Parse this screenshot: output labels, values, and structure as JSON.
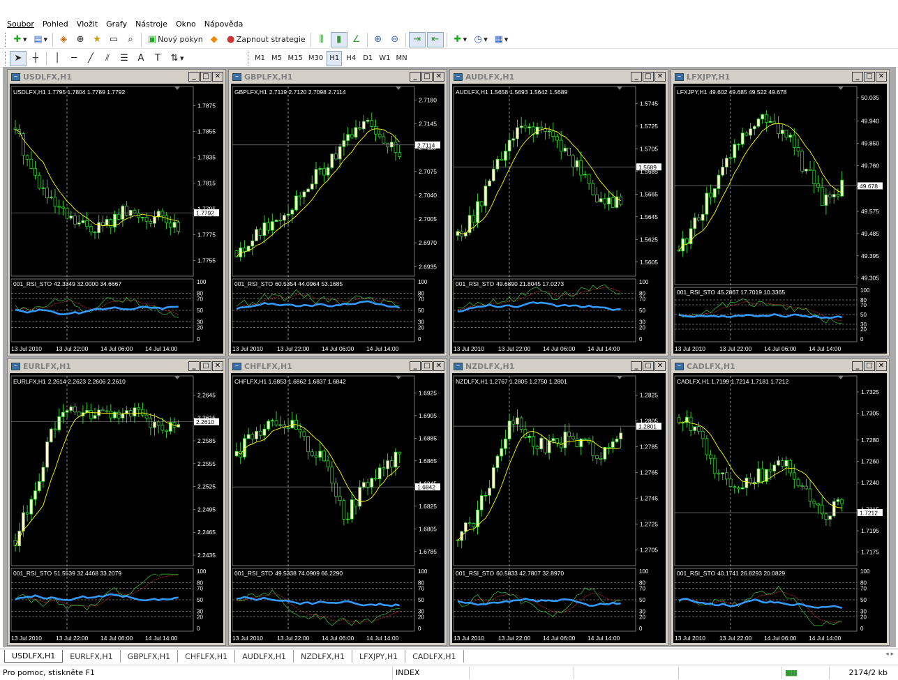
{
  "menu": [
    "Soubor",
    "Pohled",
    "Vložit",
    "Grafy",
    "Nástroje",
    "Okno",
    "Nápověda"
  ],
  "toolbar1": {
    "new_order": "Nový pokyn",
    "strategy": "Zapnout strategie"
  },
  "timeframes": [
    "M1",
    "M5",
    "M15",
    "M30",
    "H1",
    "H4",
    "D1",
    "W1",
    "MN"
  ],
  "active_timeframe": "H1",
  "indicator_label": "001_RSI_STO",
  "rsi_levels": [
    "100",
    "80",
    "70",
    "50",
    "30",
    "20",
    "0"
  ],
  "time_labels": [
    "13 Jul 2010",
    "13 Jul 22:00",
    "14 Jul 06:00",
    "14 Jul 14:00"
  ],
  "colors": {
    "bull": "#ffffcc",
    "bear": "#000000",
    "wick": "#33cc33",
    "ma": "#ffff00",
    "rsi": "#3399ff",
    "sto_main": "#33cc33",
    "sto_signal": "#cc3333",
    "grid": "#c0c0c0",
    "bg": "#000000",
    "text": "#ffffff"
  },
  "charts": [
    {
      "title": "USDLFX,H1",
      "symbol": "USDLFX,H1",
      "ohlc": "1.7795 1.7804 1.7789 1.7792",
      "price": "1.7792",
      "levels": [
        "1.7875",
        "1.7855",
        "1.7835",
        "1.7815",
        "1.7795",
        "1.7775",
        "1.7755"
      ],
      "ymin": 1.7745,
      "ymax": 1.789,
      "ind_values": "42.3349 32.0000 34.6667"
    },
    {
      "title": "GBPLFX,H1",
      "symbol": "GBPLFX,H1",
      "ohlc": "2.7119 2.7120 2.7098 2.7114",
      "price": "2.7114",
      "levels": [
        "2.7180",
        "2.7145",
        "2.7110",
        "2.7075",
        "2.7040",
        "2.7005",
        "2.6970",
        "2.6935"
      ],
      "ymin": 2.6925,
      "ymax": 2.72,
      "ind_values": "60.5354 44.0964 53.1685"
    },
    {
      "title": "AUDLFX,H1",
      "symbol": "AUDLFX,H1",
      "ohlc": "1.5658 1.5693 1.5642 1.5689",
      "price": "1.5689",
      "levels": [
        "1.5745",
        "1.5725",
        "1.5705",
        "1.5685",
        "1.5665",
        "1.5645",
        "1.5625",
        "1.5605"
      ],
      "ymin": 1.5595,
      "ymax": 1.576,
      "ind_values": "49.6890 21.8045 17.0273"
    },
    {
      "title": "LFXJPY,H1",
      "symbol": "LFXJPY,H1",
      "ohlc": "49.602 49.685 49.522 49.678",
      "price": "49.678",
      "levels": [
        "50.035",
        "49.940",
        "49.850",
        "49.760",
        "49.675",
        "49.575",
        "49.485",
        "49.395",
        "49.305"
      ],
      "ymin": 49.29,
      "ymax": 50.08,
      "ind_values": "45.2867 17.7019 10.3365"
    },
    {
      "title": "EURLFX,H1",
      "symbol": "EURLFX,H1",
      "ohlc": "2.2614 2.2623 2.2606 2.2610",
      "price": "2.2610",
      "levels": [
        "2.2645",
        "2.2615",
        "2.2585",
        "2.2555",
        "2.2525",
        "2.2495",
        "2.2465",
        "2.2435"
      ],
      "ymin": 2.2425,
      "ymax": 2.267,
      "ind_values": "51.5539 32.4468 33.2079"
    },
    {
      "title": "CHFLFX,H1",
      "symbol": "CHFLFX,H1",
      "ohlc": "1.6853 1.6862 1.6837 1.6842",
      "price": "1.6842",
      "levels": [
        "1.6925",
        "1.6905",
        "1.6885",
        "1.6865",
        "1.6845",
        "1.6825",
        "1.6805",
        "1.6785"
      ],
      "ymin": 1.6775,
      "ymax": 1.694,
      "ind_values": "49.5338 74.0909 66.2290"
    },
    {
      "title": "NZDLFX,H1",
      "symbol": "NZDLFX,H1",
      "ohlc": "1.2767 1.2805 1.2750 1.2801",
      "price": "1.2801",
      "levels": [
        "1.2825",
        "1.2805",
        "1.2785",
        "1.2765",
        "1.2745",
        "1.2725",
        "1.2705"
      ],
      "ymin": 1.2695,
      "ymax": 1.284,
      "ind_values": "60.5833 42.7807 32.8970"
    },
    {
      "title": "CADLFX,H1",
      "symbol": "CADLFX,H1",
      "ohlc": "1.7199 1.7214 1.7181 1.7212",
      "price": "1.7212",
      "levels": [
        "1.7325",
        "1.7305",
        "1.7280",
        "1.7260",
        "1.7240",
        "1.7215",
        "1.7195",
        "1.7175"
      ],
      "ymin": 1.7165,
      "ymax": 1.734,
      "ind_values": "40.1741 26.8293 20.0829"
    }
  ],
  "tabs": [
    "USDLFX,H1",
    "EURLFX,H1",
    "GBPLFX,H1",
    "CHFLFX,H1",
    "AUDLFX,H1",
    "NZDLFX,H1",
    "LFXJPY,H1",
    "CADLFX,H1"
  ],
  "active_tab": "USDLFX,H1",
  "status": {
    "help": "Pro pomoc, stiskněte F1",
    "profile": "INDEX",
    "traffic": "2174/2 kb"
  }
}
